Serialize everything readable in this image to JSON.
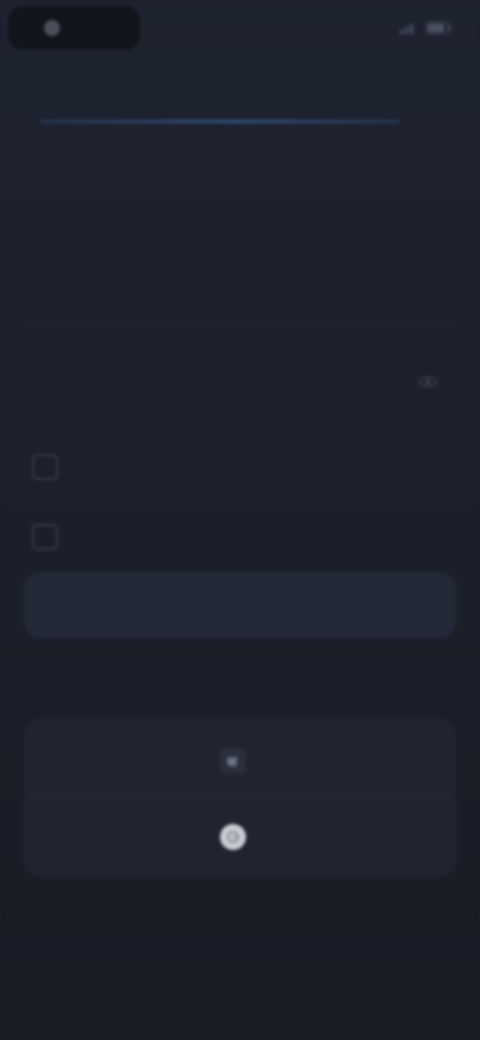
{
  "status_bar": {
    "app_name": "",
    "right_text": ""
  },
  "header": {
    "title": ""
  },
  "back_link": "",
  "page_title": "",
  "form": {
    "username": {
      "value": "",
      "placeholder": ""
    },
    "password": {
      "value": "",
      "placeholder": ""
    },
    "terms_label": "",
    "newsletter_label": "",
    "submit_label": ""
  },
  "social": {
    "apple_label": "",
    "google_label": ""
  },
  "footer": "",
  "icons": {
    "password_toggle": "eye-icon",
    "apple": "apple-icon",
    "google": "google-icon"
  },
  "colors": {
    "background": "#1b1f2a",
    "accent": "#3a5b8f",
    "card": "#20242f",
    "button": "#232937"
  }
}
